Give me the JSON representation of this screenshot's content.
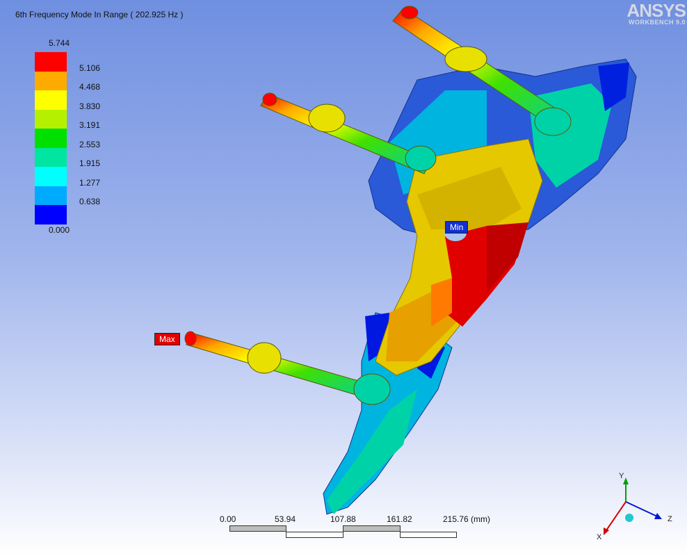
{
  "title": "6th Frequency Mode In Range ( 202.925 Hz )",
  "logo": {
    "brand": "ANSYS",
    "sub": "WORKBENCH 9.0"
  },
  "legend": {
    "max": "5.744",
    "ticks": [
      "5.106",
      "4.468",
      "3.830",
      "3.191",
      "2.553",
      "1.915",
      "1.277",
      "0.638"
    ],
    "min": "0.000",
    "colors": [
      "#ff0000",
      "#ffaa00",
      "#ffff00",
      "#b4f000",
      "#00e000",
      "#00e6a0",
      "#00ffff",
      "#00aaff",
      "#0000ff"
    ]
  },
  "probes": {
    "max_label": "Max",
    "min_label": "Min"
  },
  "scale_bar": {
    "labels": [
      "0.00",
      "53.94",
      "107.88",
      "161.82",
      "215.76 (mm)"
    ]
  },
  "axes": {
    "x": "X",
    "y": "Y",
    "z": "Z"
  }
}
